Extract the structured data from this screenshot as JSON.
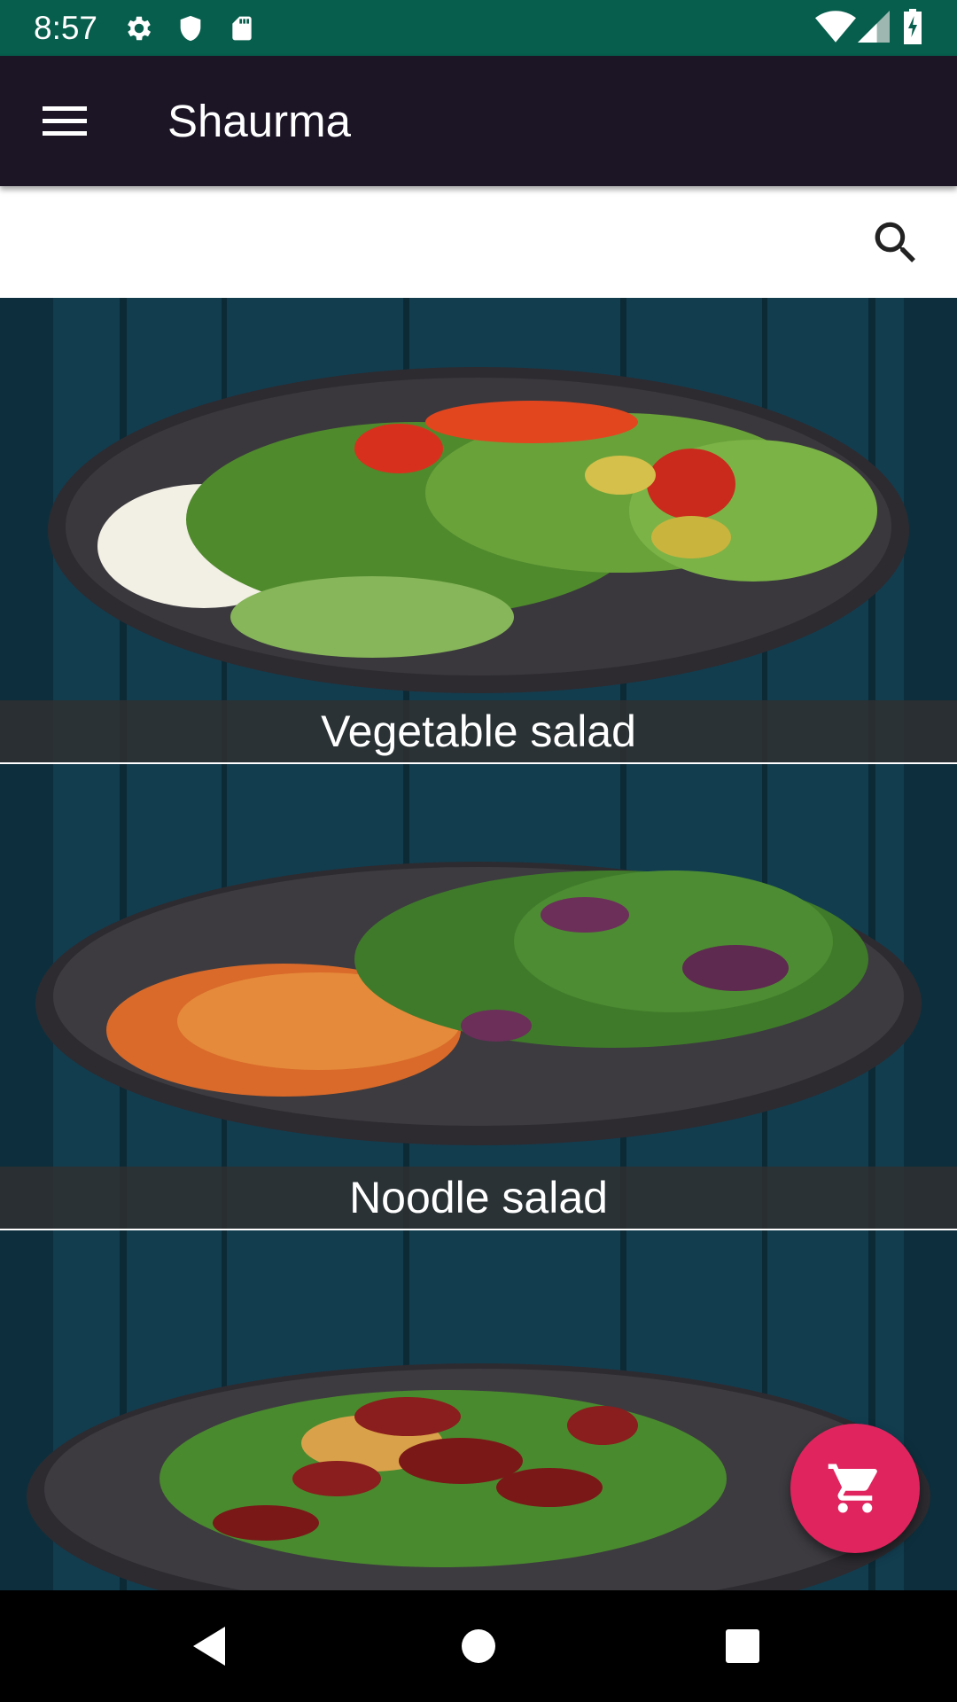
{
  "status_bar": {
    "time": "8:57",
    "left_icons": [
      "gear-icon",
      "shield-icon",
      "sd-card-icon"
    ],
    "right_icons": [
      "wifi-icon",
      "signal-icon",
      "battery-icon"
    ],
    "background_color": "#075e4c"
  },
  "app_bar": {
    "title": "Shaurma",
    "menu_icon": "menu-icon",
    "background_color": "#1c1526"
  },
  "search": {
    "icon": "search-icon"
  },
  "food_items": [
    {
      "name": "Vegetable salad"
    },
    {
      "name": "Noodle salad"
    },
    {
      "name": ""
    }
  ],
  "fab": {
    "icon": "cart-icon",
    "color": "#e0245e"
  },
  "nav_bar": {
    "buttons": [
      "back-icon",
      "home-icon",
      "recents-icon"
    ]
  }
}
